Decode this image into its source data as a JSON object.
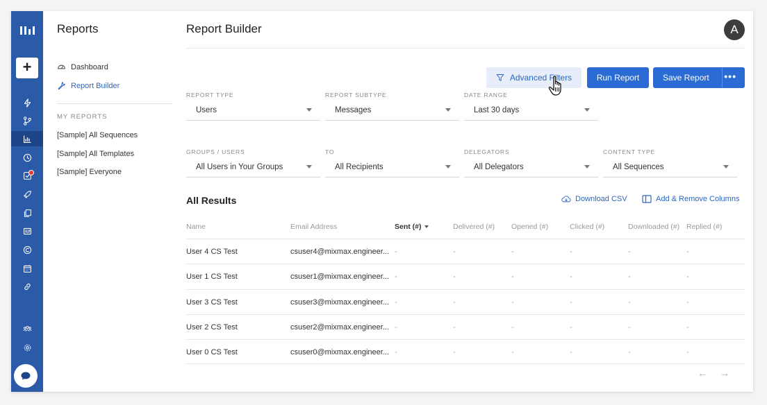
{
  "sidebar": {
    "title": "Reports",
    "nav": [
      {
        "label": "Dashboard",
        "icon": "gauge-icon"
      },
      {
        "label": "Report Builder",
        "icon": "wrench-icon"
      }
    ],
    "section_label": "MY REPORTS",
    "reports": [
      "[Sample] All Sequences",
      "[Sample] All Templates",
      "[Sample] Everyone"
    ]
  },
  "rail": {
    "add_label": "+",
    "icons": [
      "bolt-icon",
      "branch-icon",
      "chart-icon",
      "clock-icon",
      "checkbox-icon",
      "rocket-icon",
      "copy-icon",
      "newspaper-icon",
      "copyright-icon",
      "calendar-icon",
      "link-icon",
      "team-icon",
      "settings-icon",
      "chat-icon"
    ]
  },
  "header": {
    "title": "Report Builder",
    "avatar_initial": "A"
  },
  "toolbar": {
    "advanced_filters": "Advanced Filters",
    "run_report": "Run Report",
    "save_report": "Save Report",
    "more": "•••"
  },
  "filters": {
    "report_type": {
      "label": "REPORT TYPE",
      "value": "Users"
    },
    "report_subtype": {
      "label": "REPORT SUBTYPE",
      "value": "Messages"
    },
    "date_range": {
      "label": "DATE RANGE",
      "value": "Last 30 days"
    },
    "groups_users": {
      "label": "GROUPS / USERS",
      "value": "All Users in Your Groups"
    },
    "to": {
      "label": "TO",
      "value": "All Recipients"
    },
    "delegators": {
      "label": "DELEGATORS",
      "value": "All Delegators"
    },
    "content_type": {
      "label": "CONTENT TYPE",
      "value": "All Sequences"
    }
  },
  "results": {
    "title": "All Results",
    "download_csv": "Download CSV",
    "add_remove_columns": "Add & Remove Columns",
    "columns": [
      "Name",
      "Email Address",
      "Sent (#)",
      "Delivered (#)",
      "Opened (#)",
      "Clicked (#)",
      "Downloaded (#)",
      "Replied (#)"
    ],
    "rows": [
      {
        "name": "User 4 CS Test",
        "email": "csuser4@mixmax.engineer...",
        "sent": "-",
        "delivered": "-",
        "opened": "-",
        "clicked": "-",
        "downloaded": "-",
        "replied": "-"
      },
      {
        "name": "User 1 CS Test",
        "email": "csuser1@mixmax.engineer...",
        "sent": "-",
        "delivered": "-",
        "opened": "-",
        "clicked": "-",
        "downloaded": "-",
        "replied": "-"
      },
      {
        "name": "User 3 CS Test",
        "email": "csuser3@mixmax.engineer...",
        "sent": "-",
        "delivered": "-",
        "opened": "-",
        "clicked": "-",
        "downloaded": "-",
        "replied": "-"
      },
      {
        "name": "User 2 CS Test",
        "email": "csuser2@mixmax.engineer...",
        "sent": "-",
        "delivered": "-",
        "opened": "-",
        "clicked": "-",
        "downloaded": "-",
        "replied": "-"
      },
      {
        "name": "User 0 CS Test",
        "email": "csuser0@mixmax.engineer...",
        "sent": "-",
        "delivered": "-",
        "opened": "-",
        "clicked": "-",
        "downloaded": "-",
        "replied": "-"
      }
    ],
    "pager": {
      "prev": "←",
      "next": "→"
    }
  },
  "colors": {
    "rail": "#2a5aa8",
    "accent": "#2a6bd4",
    "link": "#2a66c4"
  }
}
